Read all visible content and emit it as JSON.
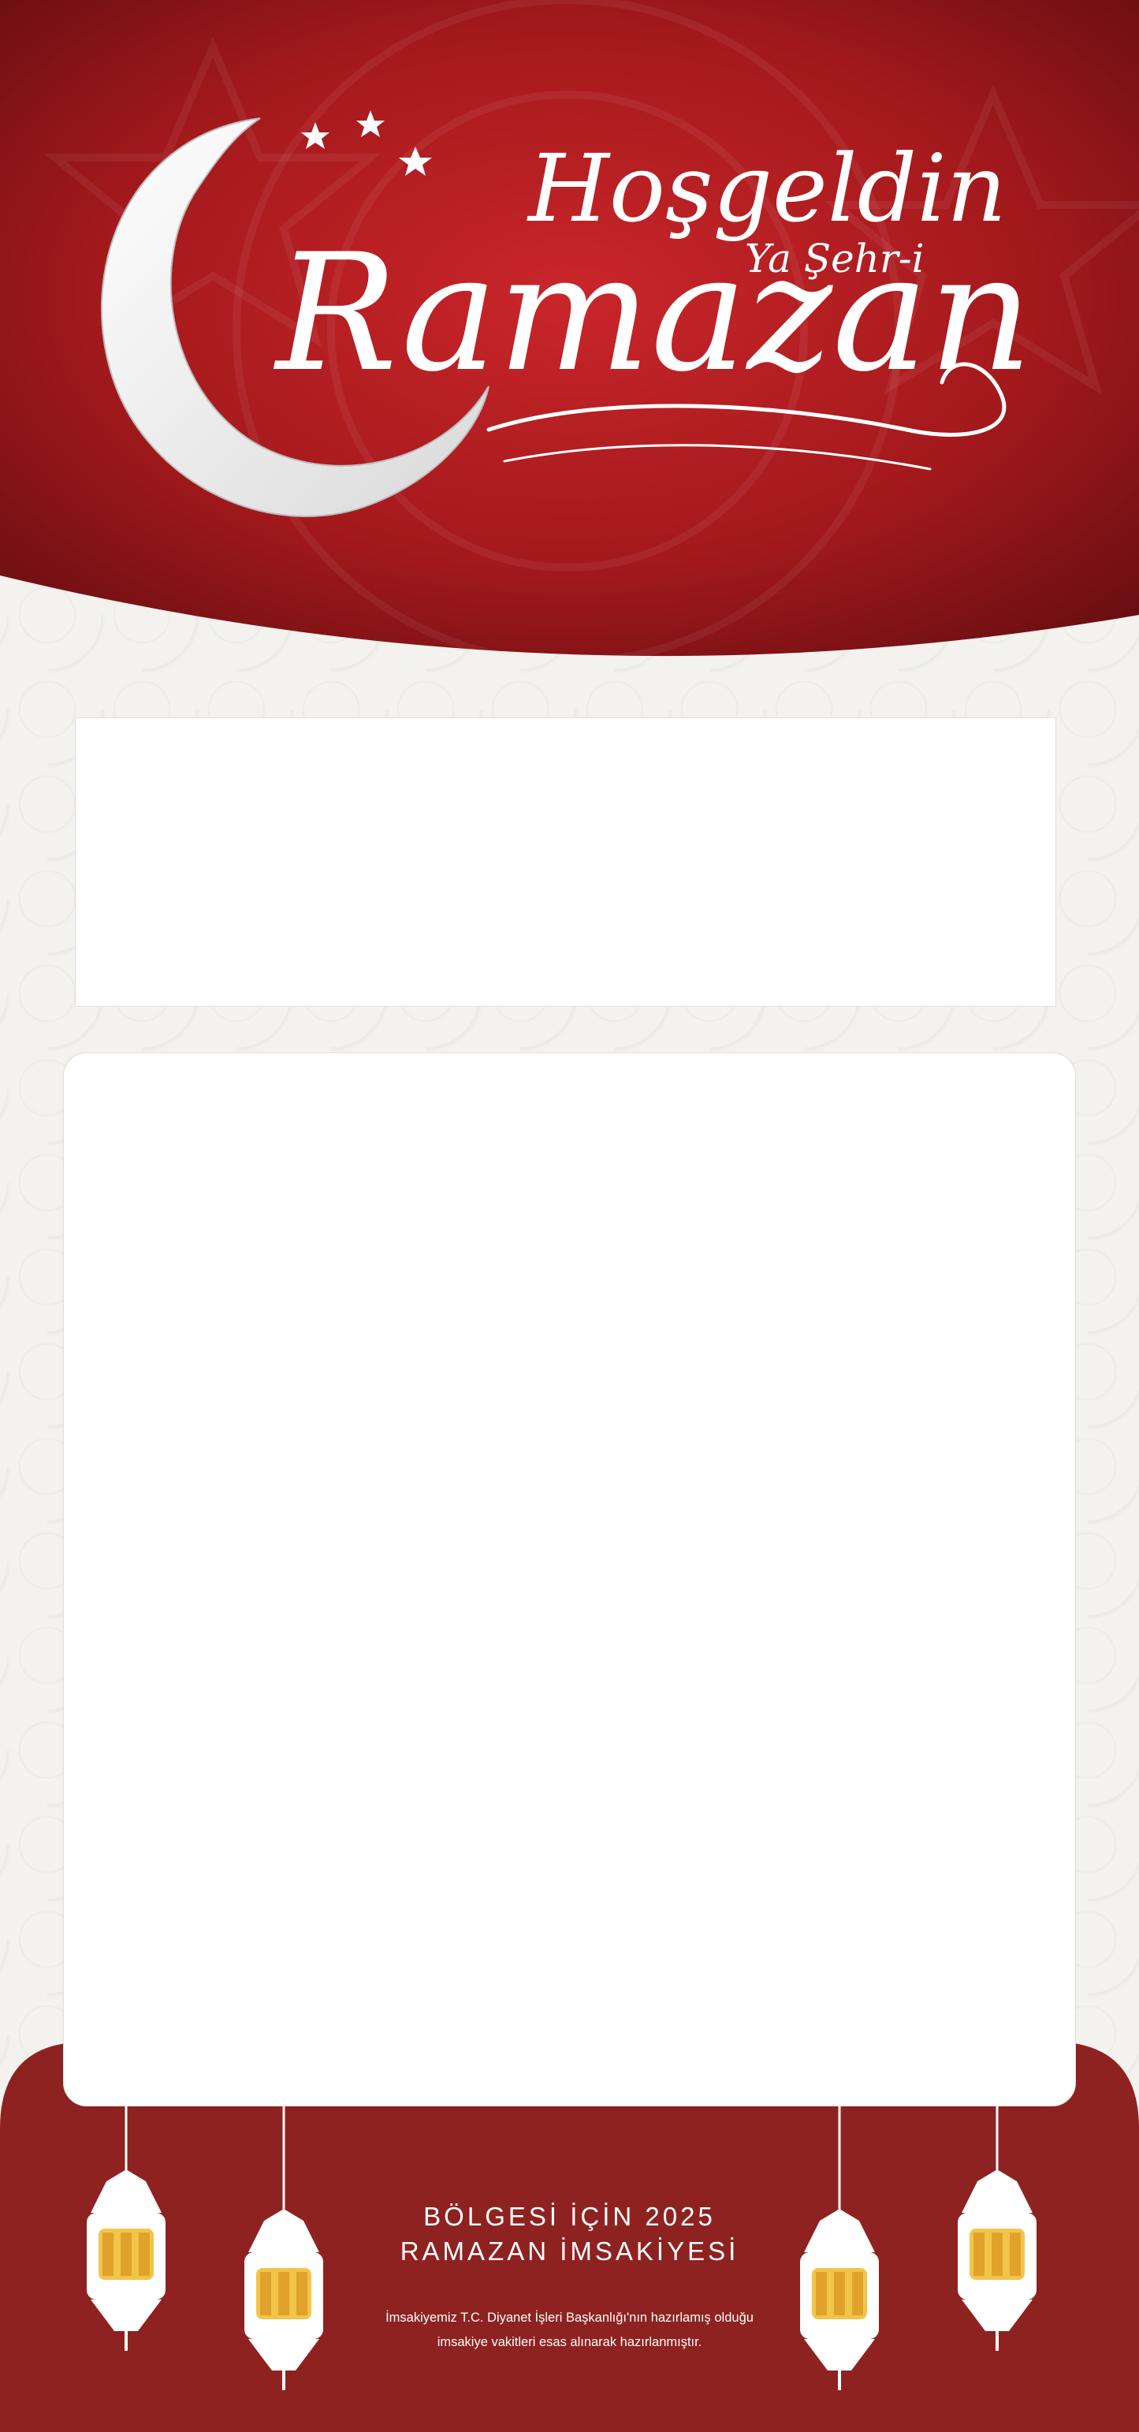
{
  "header": {
    "greeting": "Hoşgeldin",
    "subtitle": "Ya Şehr-i",
    "title": "Ramazan",
    "colors": {
      "dark_red": "#5e0c10",
      "red": "#a3191c",
      "highlight": "#c9262a"
    }
  },
  "footer": {
    "title_line1": "BÖLGESİ İÇİN 2025",
    "title_line2": "RAMAZAN İMSAKİYESİ",
    "note_line1": "İmsakiyemiz T.C. Diyanet İşleri Başkanlığı'nın hazırlamış olduğu",
    "note_line2": "imsakiye vakitleri esas alınarak hazırlanmıştır.",
    "color": "#8e2220"
  },
  "icons": [
    "crescent-moon-icon",
    "star-icon",
    "lantern-icon"
  ]
}
